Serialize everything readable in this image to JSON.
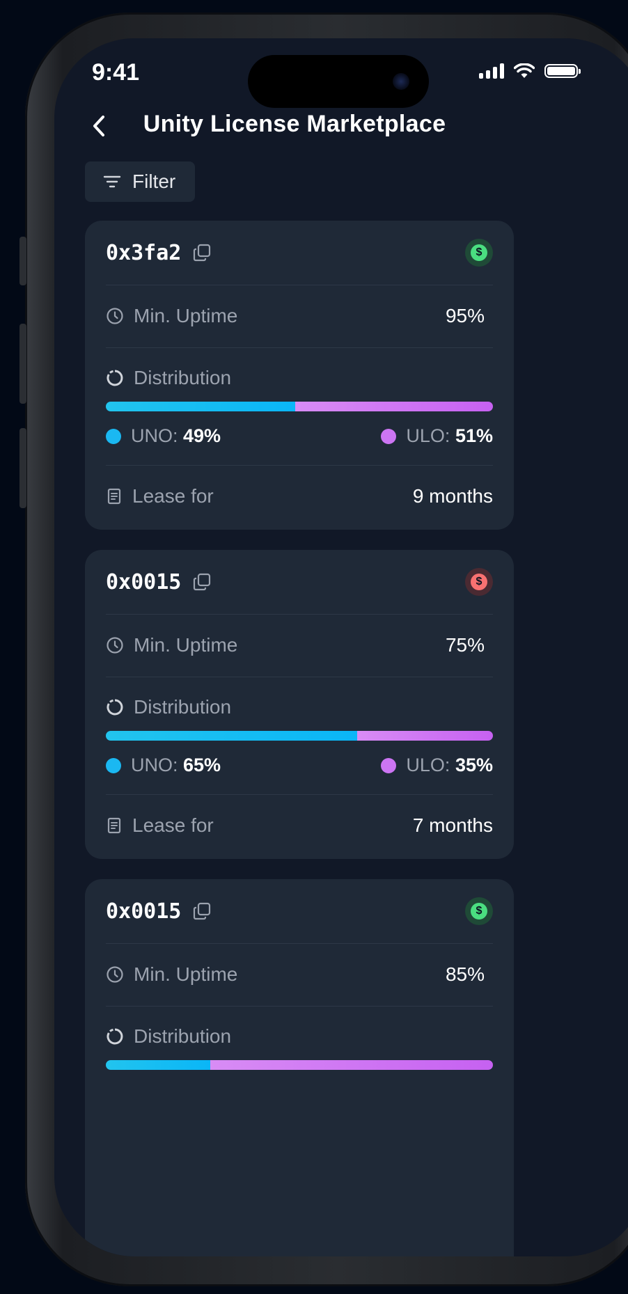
{
  "status_bar": {
    "time": "9:41"
  },
  "header": {
    "title": "Unity License Marketplace"
  },
  "filter": {
    "label": "Filter"
  },
  "labels": {
    "min_uptime": "Min. Uptime",
    "distribution": "Distribution",
    "lease_for": "Lease for",
    "uno": "UNO:",
    "ulo": "ULO:"
  },
  "colors": {
    "background": "#111827",
    "card": "#1f2937",
    "uno": "#1ab8f2",
    "ulo": "#cc75f3",
    "price_green": "#4ade80",
    "price_red": "#f87171"
  },
  "cards": [
    {
      "id": "0x3fa2",
      "price_status": "green",
      "min_uptime": "95%",
      "uno_pct": "49%",
      "ulo_pct": "51%",
      "uno_fraction": 0.49,
      "lease": "9 months"
    },
    {
      "id": "0x0015",
      "price_status": "red",
      "min_uptime": "75%",
      "uno_pct": "65%",
      "ulo_pct": "35%",
      "uno_fraction": 0.65,
      "lease": "7 months"
    },
    {
      "id": "0x0015",
      "price_status": "green",
      "min_uptime": "85%",
      "uno_fraction": 0.27
    }
  ]
}
